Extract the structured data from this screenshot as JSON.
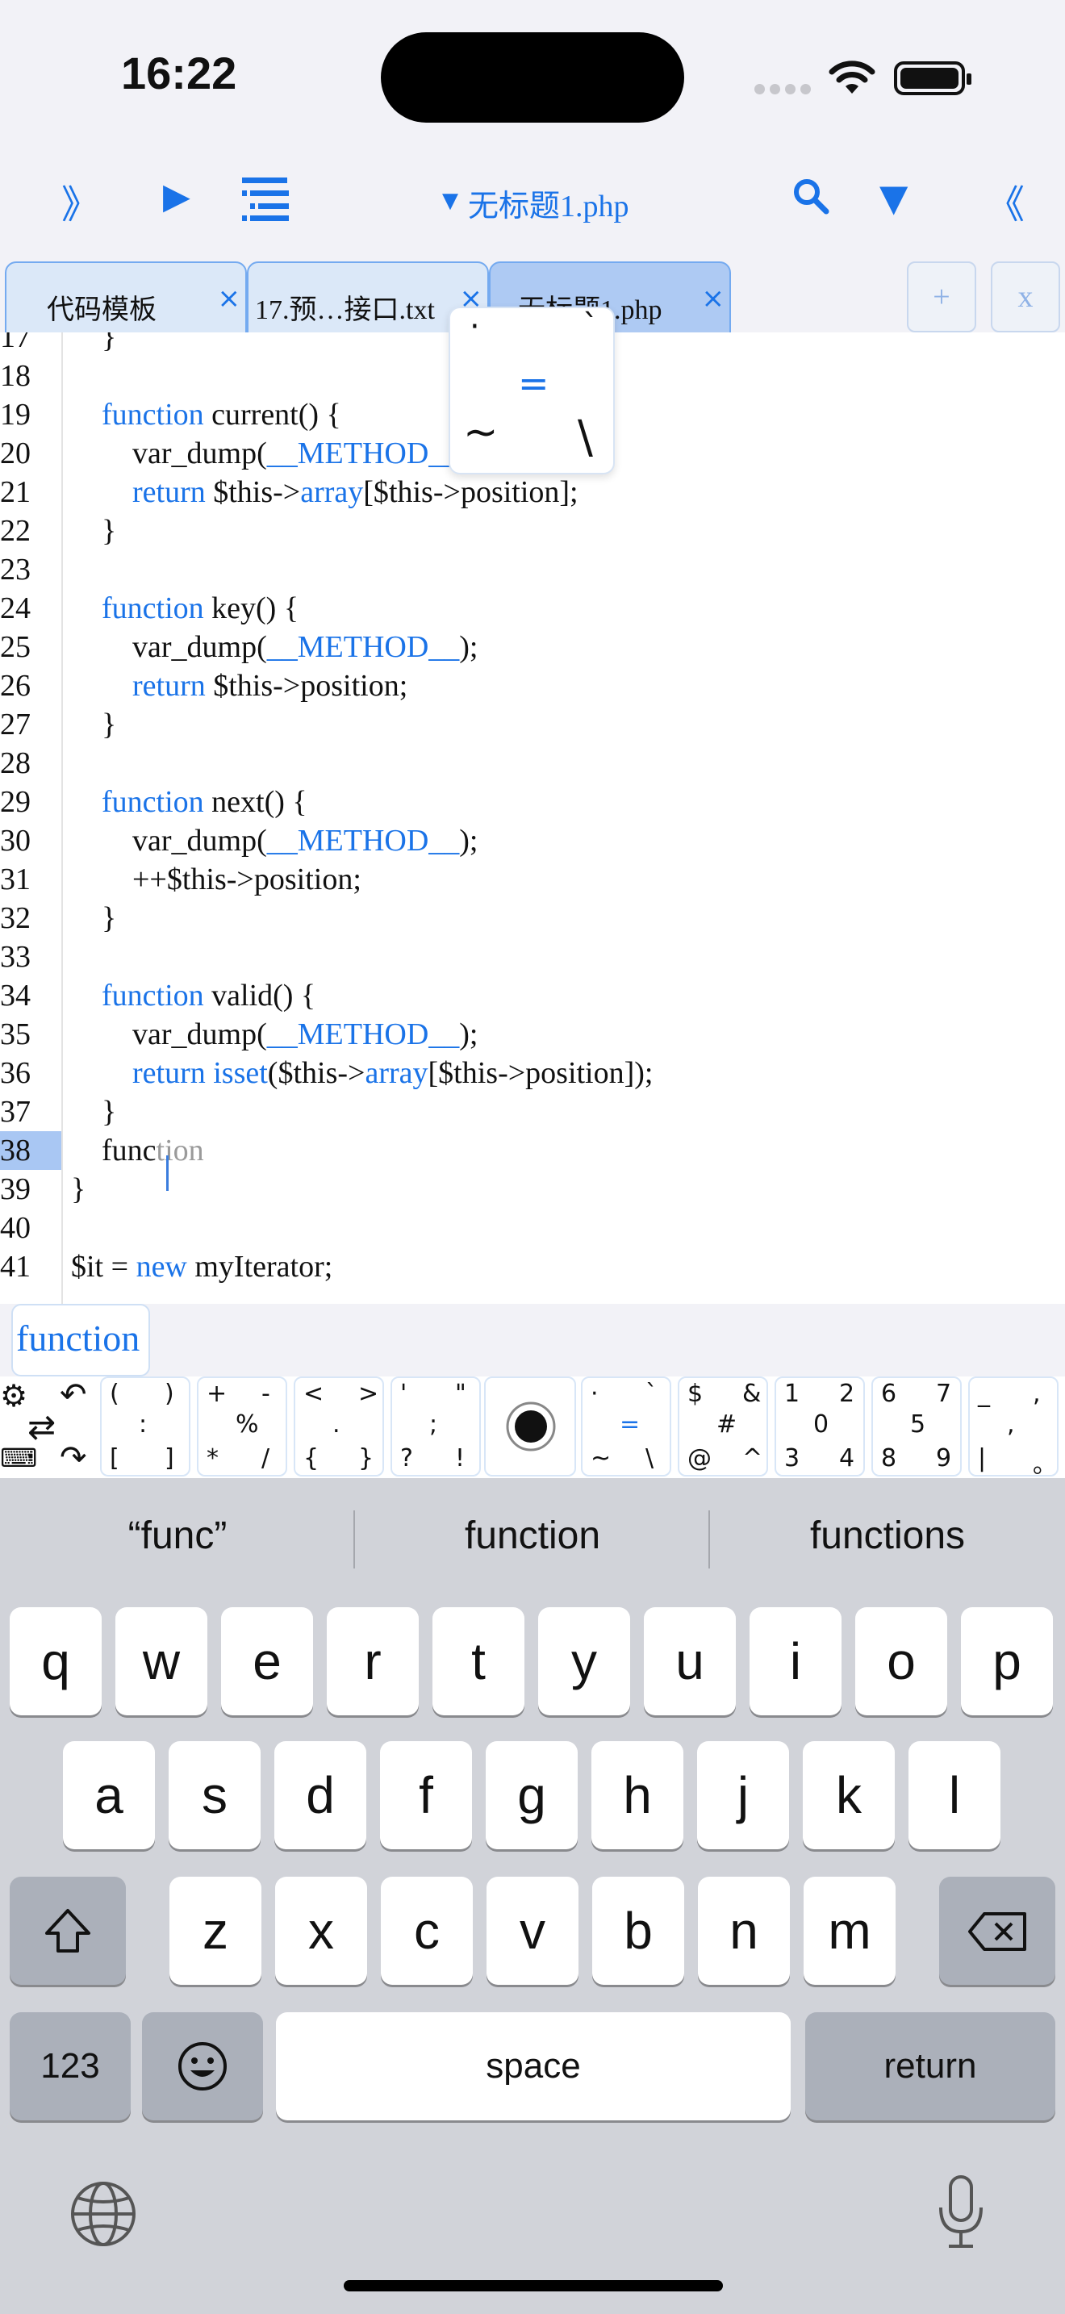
{
  "status": {
    "time": "16:22"
  },
  "toolbar": {
    "file_title": "无标题1.php",
    "icons": [
      "expand-right-icon",
      "run-icon",
      "outline-list-icon",
      "search-icon",
      "dropdown-icon",
      "collapse-left-icon"
    ]
  },
  "tabs": [
    {
      "label": "代码模板",
      "close": "×"
    },
    {
      "label": "17.预…接口.txt",
      "close": "×"
    },
    {
      "label": "无标题1.php",
      "close": "×"
    }
  ],
  "tab_actions": {
    "add": "+",
    "close": "x"
  },
  "editor": {
    "lines": [
      {
        "n": "17",
        "code": "    }"
      },
      {
        "n": "18",
        "code": ""
      },
      {
        "n": "19",
        "code": "    function current() {"
      },
      {
        "n": "20",
        "code": "        var_dump(__METHOD__);"
      },
      {
        "n": "21",
        "code": "        return $this->array[$this->position];"
      },
      {
        "n": "22",
        "code": "    }"
      },
      {
        "n": "23",
        "code": ""
      },
      {
        "n": "24",
        "code": "    function key() {"
      },
      {
        "n": "25",
        "code": "        var_dump(__METHOD__);"
      },
      {
        "n": "26",
        "code": "        return $this->position;"
      },
      {
        "n": "27",
        "code": "    }"
      },
      {
        "n": "28",
        "code": ""
      },
      {
        "n": "29",
        "code": "    function next() {"
      },
      {
        "n": "30",
        "code": "        var_dump(__METHOD__);"
      },
      {
        "n": "31",
        "code": "        ++$this->position;"
      },
      {
        "n": "32",
        "code": "    }"
      },
      {
        "n": "33",
        "code": ""
      },
      {
        "n": "34",
        "code": "    function valid() {"
      },
      {
        "n": "35",
        "code": "        var_dump(__METHOD__);"
      },
      {
        "n": "36",
        "code": "        return isset($this->array[$this->position]);"
      },
      {
        "n": "37",
        "code": "    }"
      },
      {
        "n": "38",
        "code": "    function"
      },
      {
        "n": "39",
        "code": "}"
      },
      {
        "n": "40",
        "code": ""
      },
      {
        "n": "41",
        "code": "$it = new myIterator;"
      }
    ],
    "current_line": "38",
    "typed": "func",
    "ghost": "tion"
  },
  "popup": {
    "keys": [
      "·",
      "`",
      "=",
      "~",
      "\\"
    ]
  },
  "autocomplete": {
    "suggestion": "function"
  },
  "accessory": {
    "groups": [
      [
        "(",
        ")",
        ":",
        "[",
        "]"
      ],
      [
        "+",
        "-",
        "%",
        "*",
        "/"
      ],
      [
        "<",
        ">",
        ".",
        "{",
        "}"
      ],
      [
        "'",
        "\"",
        ";",
        "?",
        "!"
      ],
      [
        "·",
        "`",
        "=",
        "~",
        "\\"
      ],
      [
        "$",
        "&",
        "#",
        "@",
        "^"
      ],
      [
        "1",
        "2",
        "0",
        "3",
        "4"
      ],
      [
        "6",
        "7",
        "5",
        "8",
        "9"
      ],
      [
        "_",
        ",",
        ",",
        "|",
        "。"
      ]
    ]
  },
  "suggestions": [
    "“func”",
    "function",
    "functions"
  ],
  "keyboard": {
    "row1": [
      "q",
      "w",
      "e",
      "r",
      "t",
      "y",
      "u",
      "i",
      "o",
      "p"
    ],
    "row2": [
      "a",
      "s",
      "d",
      "f",
      "g",
      "h",
      "j",
      "k",
      "l"
    ],
    "row3": [
      "z",
      "x",
      "c",
      "v",
      "b",
      "n",
      "m"
    ],
    "numbers": "123",
    "space": "space",
    "return": "return"
  },
  "colors": {
    "accent": "#1a73e8",
    "line_highlight": "#a9c7f3",
    "keyboard_bg": "#d1d3d9"
  }
}
